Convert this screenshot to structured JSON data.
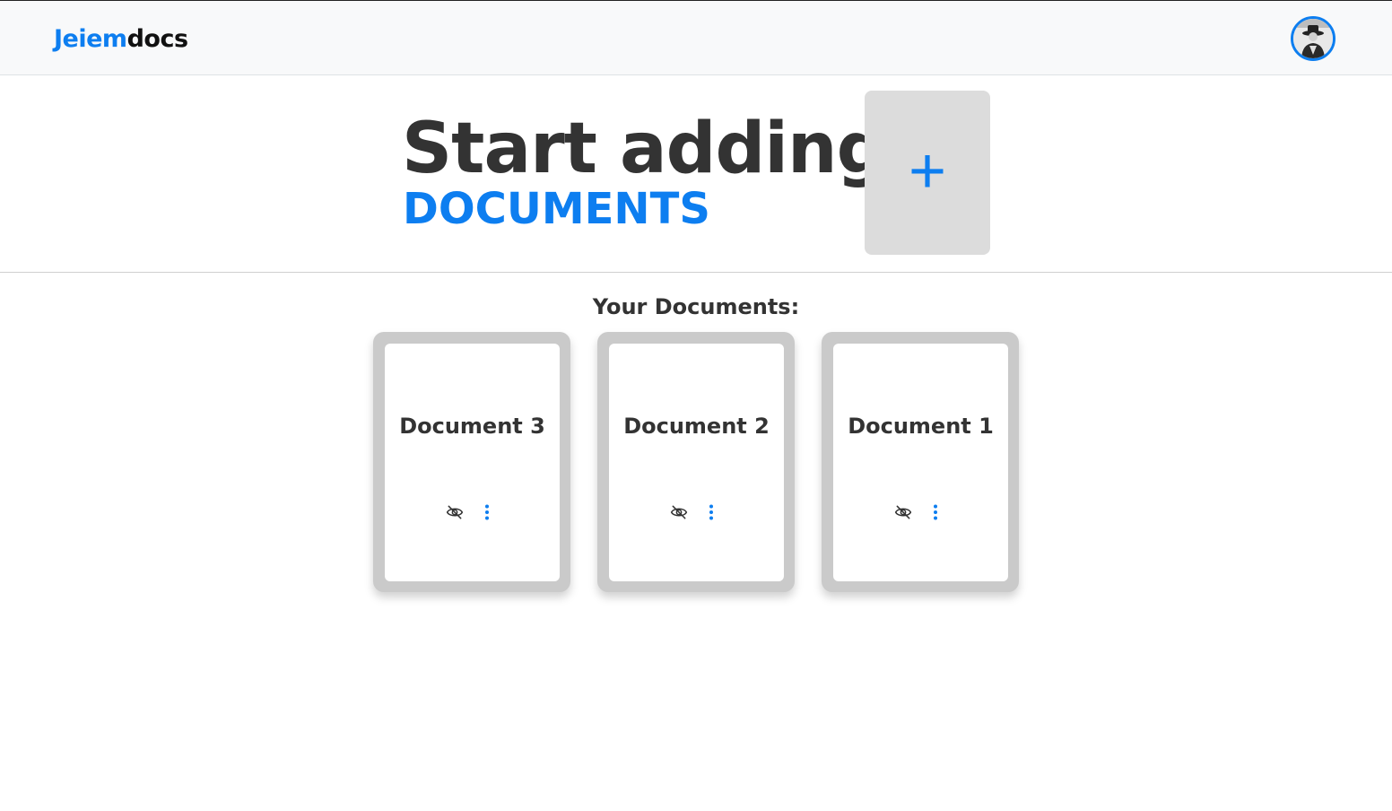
{
  "navbar": {
    "brand_part1": "Jeiem",
    "brand_part2": "docs",
    "avatar_icon": "user-avatar"
  },
  "hero": {
    "title": "Start adding",
    "subtitle": "DOCUMENTS",
    "add_button_label": "+"
  },
  "documents_section": {
    "title": "Your Documents:",
    "documents": [
      {
        "title": "Document 3",
        "visibility_icon": "eye-slash-icon",
        "menu_icon": "more-vertical-icon"
      },
      {
        "title": "Document 2",
        "visibility_icon": "eye-slash-icon",
        "menu_icon": "more-vertical-icon"
      },
      {
        "title": "Document 1",
        "visibility_icon": "eye-slash-icon",
        "menu_icon": "more-vertical-icon"
      }
    ]
  },
  "colors": {
    "accent": "#0d7ef0",
    "text": "#333333",
    "navbar_bg": "#f8f9fa",
    "add_button_bg": "#dcdcdc",
    "card_frame": "#cacaca"
  }
}
